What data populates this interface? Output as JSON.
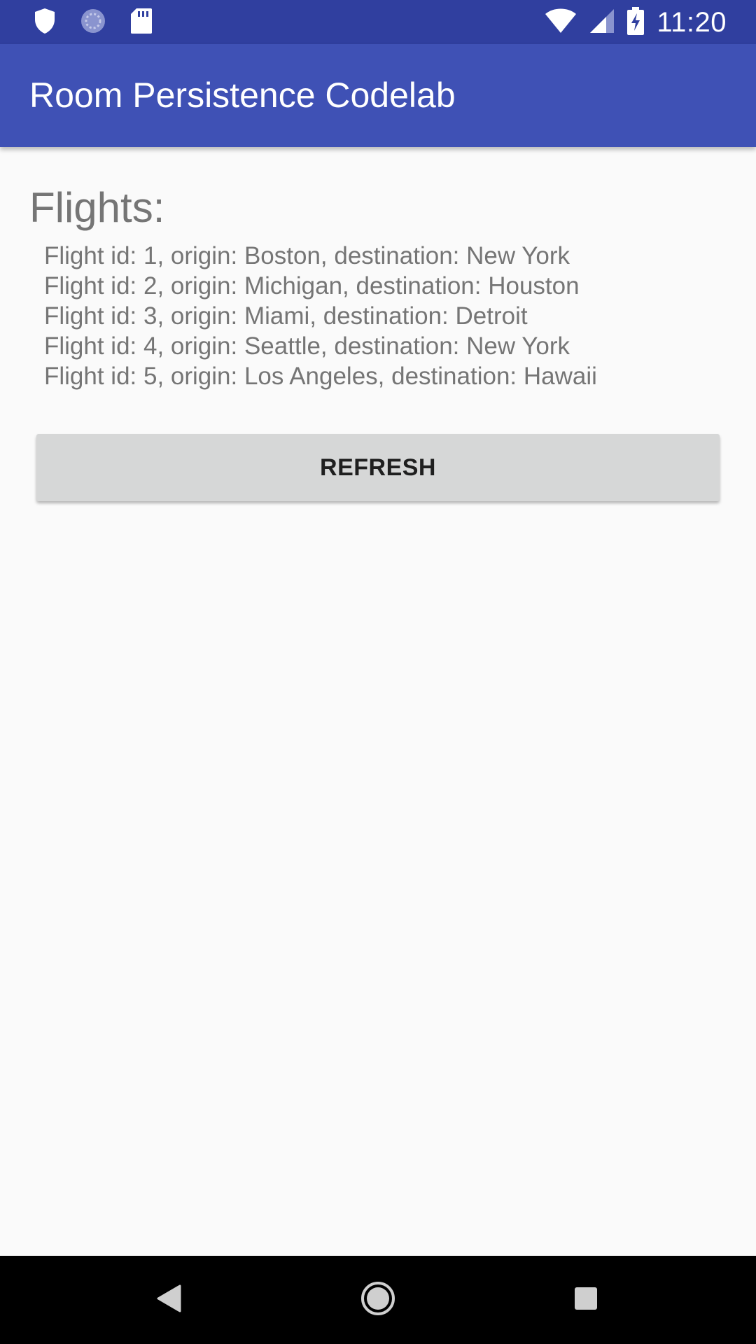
{
  "status_bar": {
    "time": "11:20",
    "icons_left": [
      "shield-icon",
      "sync-icon",
      "sd-card-icon"
    ],
    "icons_right": [
      "wifi-icon",
      "signal-icon",
      "battery-charging-icon"
    ]
  },
  "app_bar": {
    "title": "Room Persistence Codelab"
  },
  "main": {
    "heading": "Flights:",
    "flights": [
      "Flight id: 1, origin: Boston, destination: New York",
      "Flight id: 2, origin: Michigan, destination: Houston",
      "Flight id: 3, origin: Miami, destination: Detroit",
      "Flight id: 4, origin: Seattle, destination: New York",
      "Flight id: 5, origin: Los Angeles, destination: Hawaii"
    ],
    "refresh_label": "REFRESH"
  },
  "nav_bar": {
    "buttons": [
      "back-icon",
      "home-icon",
      "recents-icon"
    ]
  },
  "colors": {
    "status_bar": "#303f9f",
    "app_bar": "#3f51b5",
    "background": "#fafafa",
    "text_secondary": "#757575",
    "button": "#d6d7d7"
  }
}
